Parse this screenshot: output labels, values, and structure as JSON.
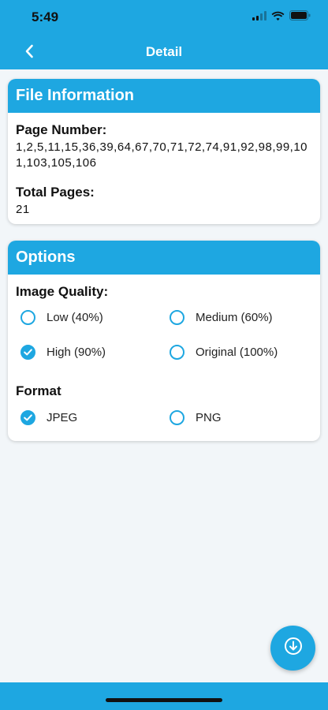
{
  "status_bar": {
    "time": "5:49"
  },
  "nav": {
    "title": "Detail",
    "back_icon": "chevron-left-icon"
  },
  "file_info": {
    "title": "File Information",
    "page_number_label": "Page Number:",
    "page_numbers": "1,2,5,11,15,36,39,64,67,70,71,72,74,91,92,98,99,101,103,105,106",
    "total_pages_label": "Total Pages:",
    "total_pages": "21"
  },
  "options": {
    "title": "Options",
    "image_quality_label": "Image Quality:",
    "image_quality": [
      {
        "label": "Low (40%)",
        "checked": false
      },
      {
        "label": "Medium (60%)",
        "checked": false
      },
      {
        "label": "High (90%)",
        "checked": true
      },
      {
        "label": "Original (100%)",
        "checked": false
      }
    ],
    "format_label": "Format",
    "format": [
      {
        "label": "JPEG",
        "checked": true
      },
      {
        "label": "PNG",
        "checked": false
      }
    ]
  },
  "fab": {
    "icon": "download-icon"
  },
  "colors": {
    "accent": "#1ea7e1",
    "background": "#f2f6f9"
  }
}
